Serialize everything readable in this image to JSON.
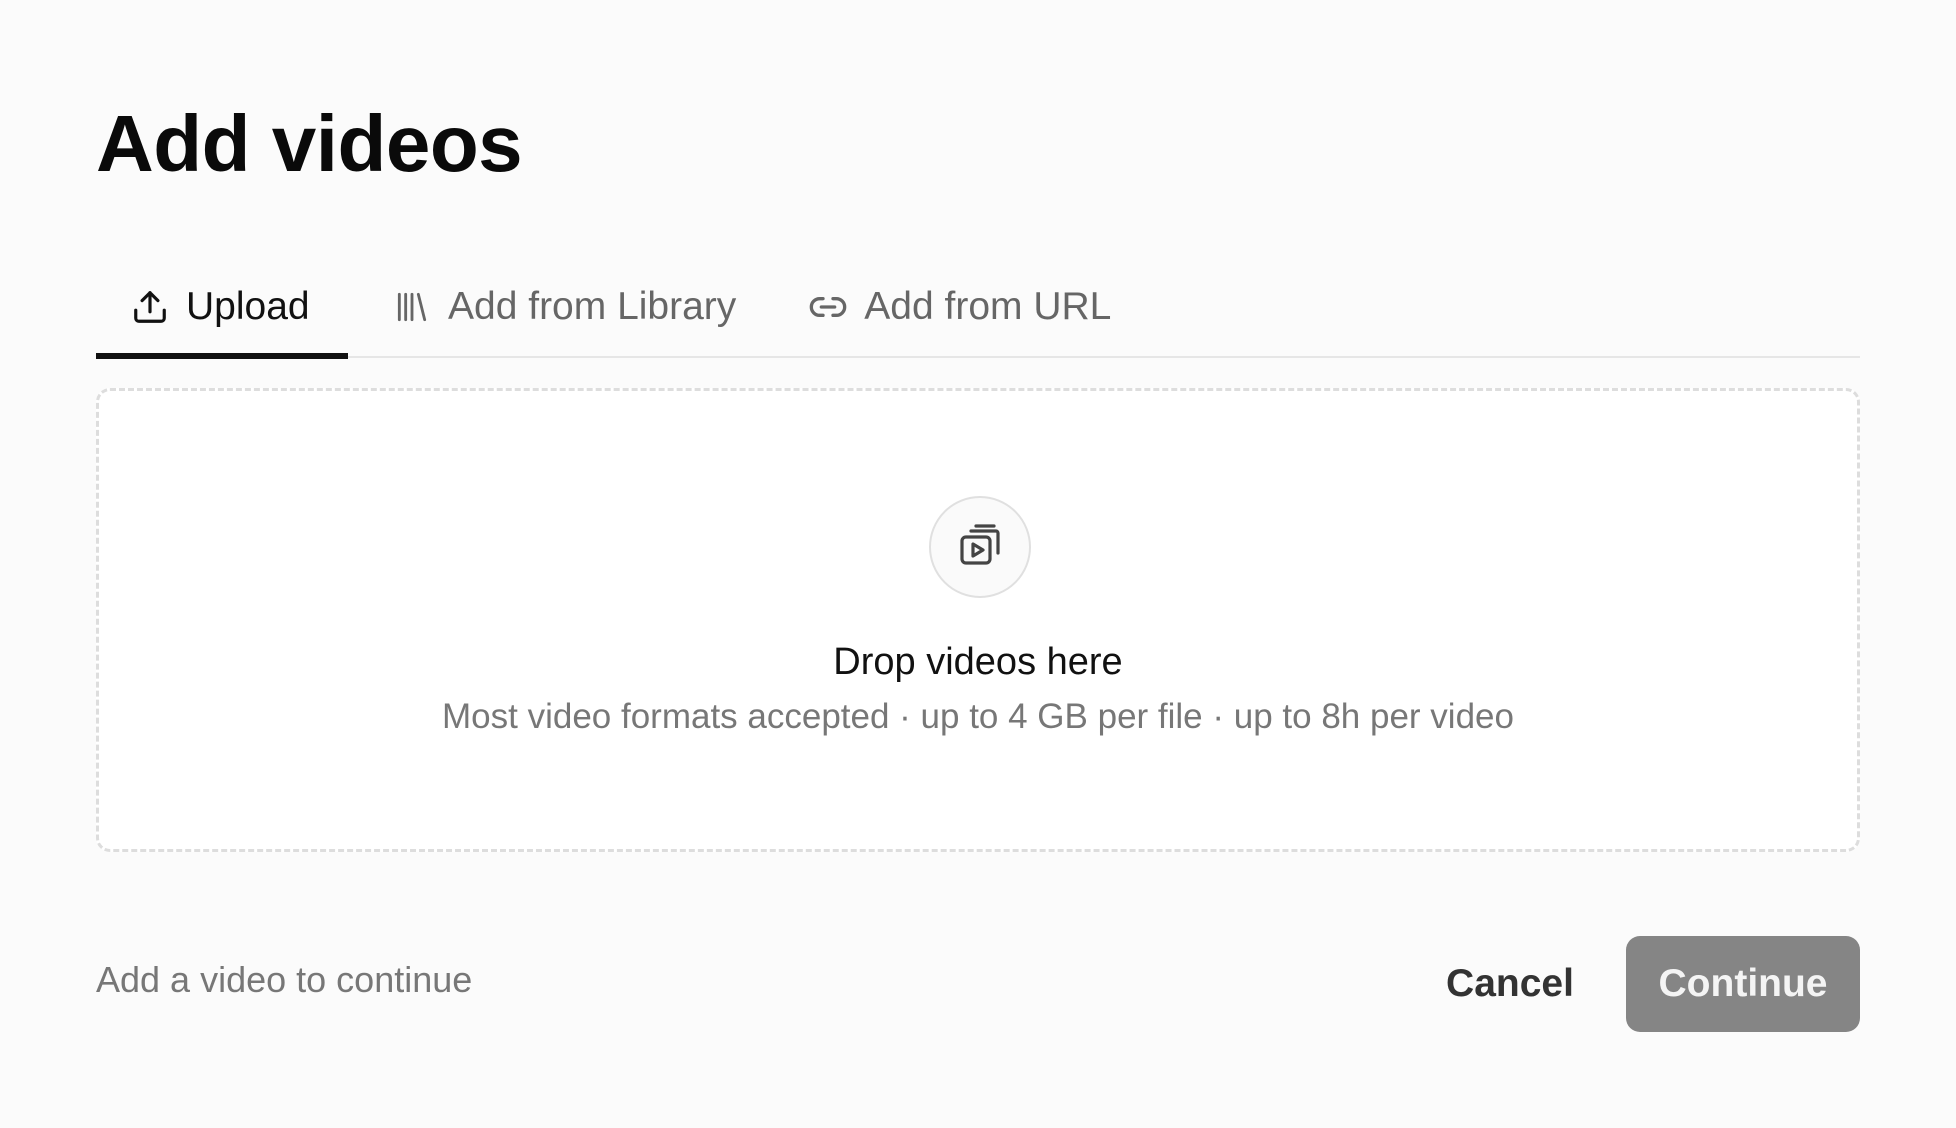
{
  "dialog": {
    "title": "Add videos"
  },
  "tabs": [
    {
      "label": "Upload",
      "icon": "upload-icon",
      "active": true
    },
    {
      "label": "Add from Library",
      "icon": "library-icon",
      "active": false
    },
    {
      "label": "Add from URL",
      "icon": "link-icon",
      "active": false
    }
  ],
  "dropzone": {
    "icon": "video-stack-icon",
    "title": "Drop videos here",
    "subtitle": "Most video formats accepted · up to 4 GB per file · up to 8h per video"
  },
  "footer": {
    "hint": "Add a video to continue",
    "cancel_label": "Cancel",
    "continue_label": "Continue",
    "continue_disabled": true
  },
  "colors": {
    "background": "#fbfbfb",
    "active_tab_underline": "#111111",
    "continue_disabled_bg": "#858585",
    "dropzone_border": "#dddddd"
  }
}
